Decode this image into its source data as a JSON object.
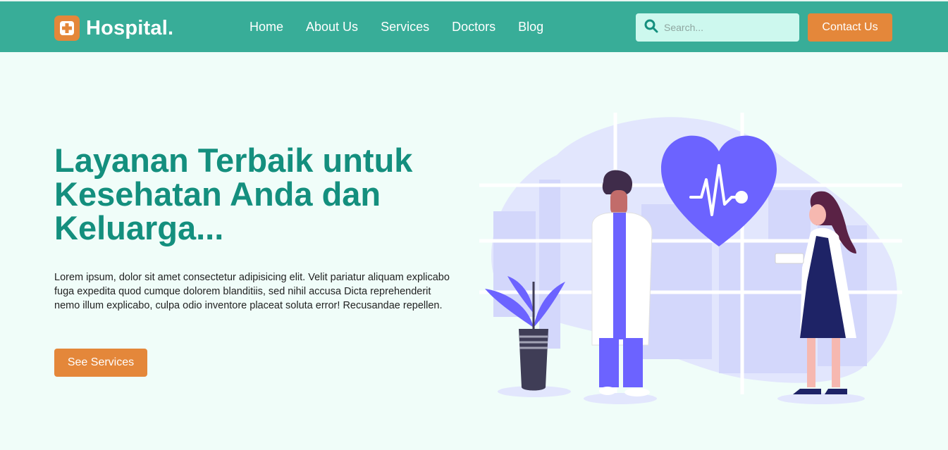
{
  "nav": {
    "logo_text": "Hospital.",
    "links": [
      "Home",
      "About Us",
      "Services",
      "Doctors",
      "Blog"
    ],
    "search_placeholder": "Search...",
    "contact_label": "Contact Us"
  },
  "hero": {
    "title": "Layanan Terbaik untuk Kesehatan Anda dan Keluarga...",
    "description": "Lorem ipsum, dolor sit amet consectetur adipisicing elit. Velit pariatur aliquam explicabo fuga expedita quod cumque dolorem blanditiis, sed nihil accusa Dicta reprehenderit nemo illum explicabo, culpa odio inventore placeat soluta error! Recusandae repellen.",
    "cta_label": "See Services"
  },
  "colors": {
    "navbar": "#38ad98",
    "accent": "#e4873a",
    "title": "#148f7e",
    "background": "#f0fdf9",
    "heart": "#6c63ff"
  },
  "icons": [
    "hospital-cross-icon",
    "search-icon"
  ]
}
